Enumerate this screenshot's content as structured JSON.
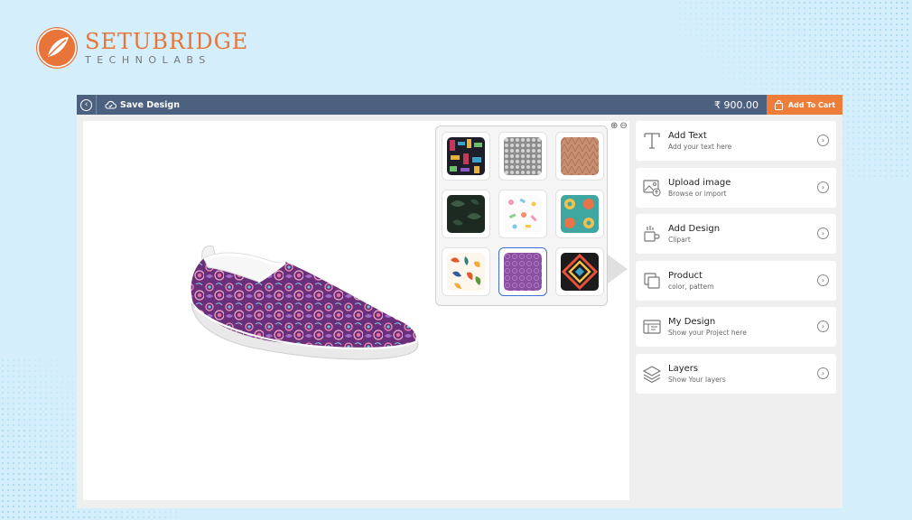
{
  "brand": {
    "name": "SETUBRIDGE",
    "sub": "TECHNOLABS",
    "accent": "#e8743a"
  },
  "topbar": {
    "back_icon": "back-arrow-icon",
    "save_label": "Save Design",
    "price": "₹ 900.00",
    "cart_label": "Add To Cart",
    "bar_color": "#4c6080",
    "cart_color": "#ee7d3a"
  },
  "zoom": {
    "in_icon": "zoom-in-icon",
    "out_icon": "zoom-out-icon"
  },
  "patterns": {
    "selected_index": 7,
    "items": [
      {
        "name": "dark-multicolor-tribal"
      },
      {
        "name": "grey-mesh"
      },
      {
        "name": "tan-geometric"
      },
      {
        "name": "dark-green-leaves"
      },
      {
        "name": "pastel-confetti"
      },
      {
        "name": "teal-mosaic"
      },
      {
        "name": "autumn-leaves"
      },
      {
        "name": "purple-paisley"
      },
      {
        "name": "aztec-diamond"
      }
    ]
  },
  "panel": {
    "items": [
      {
        "title": "Add Text",
        "subtitle": "Add your text here",
        "icon": "text-icon"
      },
      {
        "title": "Upload image",
        "subtitle": "Browse or import",
        "icon": "upload-image-icon"
      },
      {
        "title": "Add Design",
        "subtitle": "Clipart",
        "icon": "clipart-icon"
      },
      {
        "title": "Product",
        "subtitle": "color, pattern",
        "icon": "product-icon"
      },
      {
        "title": "My Design",
        "subtitle": "Show your Project here",
        "icon": "my-design-icon"
      },
      {
        "title": "Layers",
        "subtitle": "Show Your layers",
        "icon": "layers-icon"
      }
    ]
  }
}
